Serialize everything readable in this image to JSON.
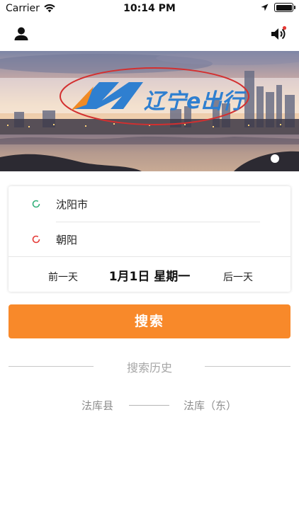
{
  "status_bar": {
    "carrier": "Carrier",
    "time": "10:14 PM",
    "icons": [
      "wifi-icon",
      "location-arrow-icon",
      "battery-icon"
    ]
  },
  "nav": {
    "left_icon": "user-icon",
    "right_icon": "speaker-icon",
    "notification_color": "#e53935"
  },
  "banner": {
    "logo_text": "辽宁e出行",
    "logo_color": "#2f7fd0",
    "logo_accent": "#f08a24",
    "highlight_color": "#d32f2f",
    "page_indicator": {
      "current": 1,
      "count": 1
    }
  },
  "route": {
    "from": {
      "label": "沈阳市",
      "dot_color": "#33b07a"
    },
    "to": {
      "label": "朝阳",
      "dot_color": "#e53935"
    },
    "date": {
      "prev_label": "前一天",
      "current": "1月1日 星期一",
      "next_label": "后一天"
    }
  },
  "search_button": {
    "label": "搜索",
    "color": "#f8892a"
  },
  "history": {
    "title": "搜索历史",
    "items": [
      {
        "from": "法库县",
        "to": "法库（东）"
      }
    ]
  }
}
